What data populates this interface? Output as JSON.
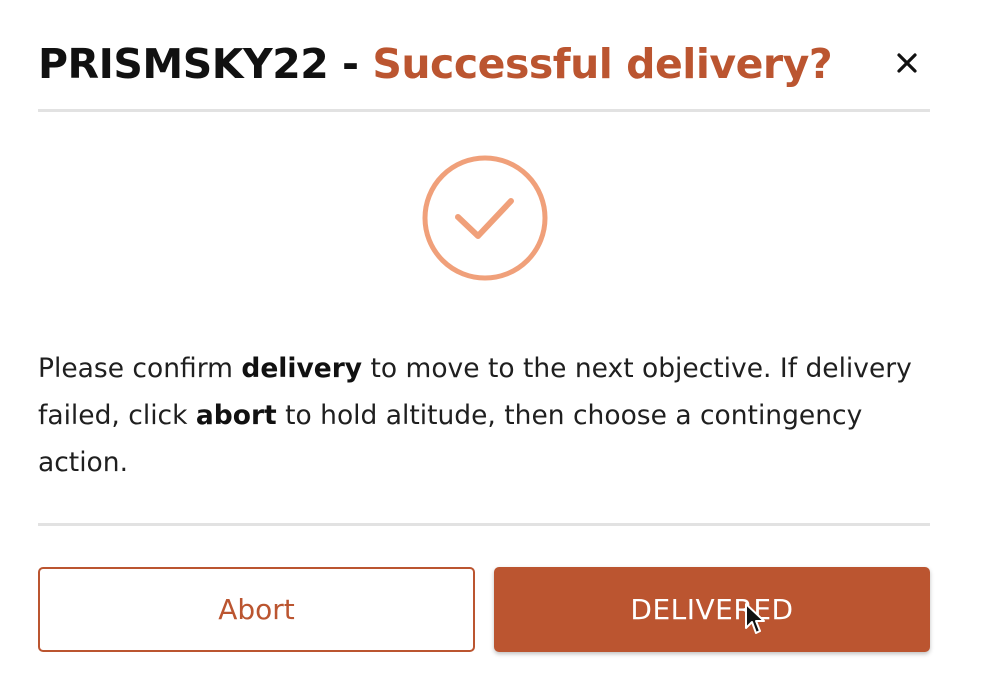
{
  "dialog": {
    "title_code": "PRISMSKY22",
    "title_separator": " - ",
    "title_question": "Successful delivery?",
    "close_symbol": "×",
    "status_icon": "checkmark-circle-icon",
    "message": {
      "part1": "Please confirm ",
      "bold1": "delivery",
      "part2": " to move to the next objective. If delivery failed, click ",
      "bold2": "abort",
      "part3": " to hold altitude, then choose a contingency action."
    },
    "buttons": {
      "abort_label": "Abort",
      "delivered_label": "DELIVERED"
    }
  },
  "colors": {
    "accent": "#bb5530",
    "check_ring": "#f0a07a",
    "divider": "#e2e2e2",
    "text": "#1f1f1f"
  }
}
